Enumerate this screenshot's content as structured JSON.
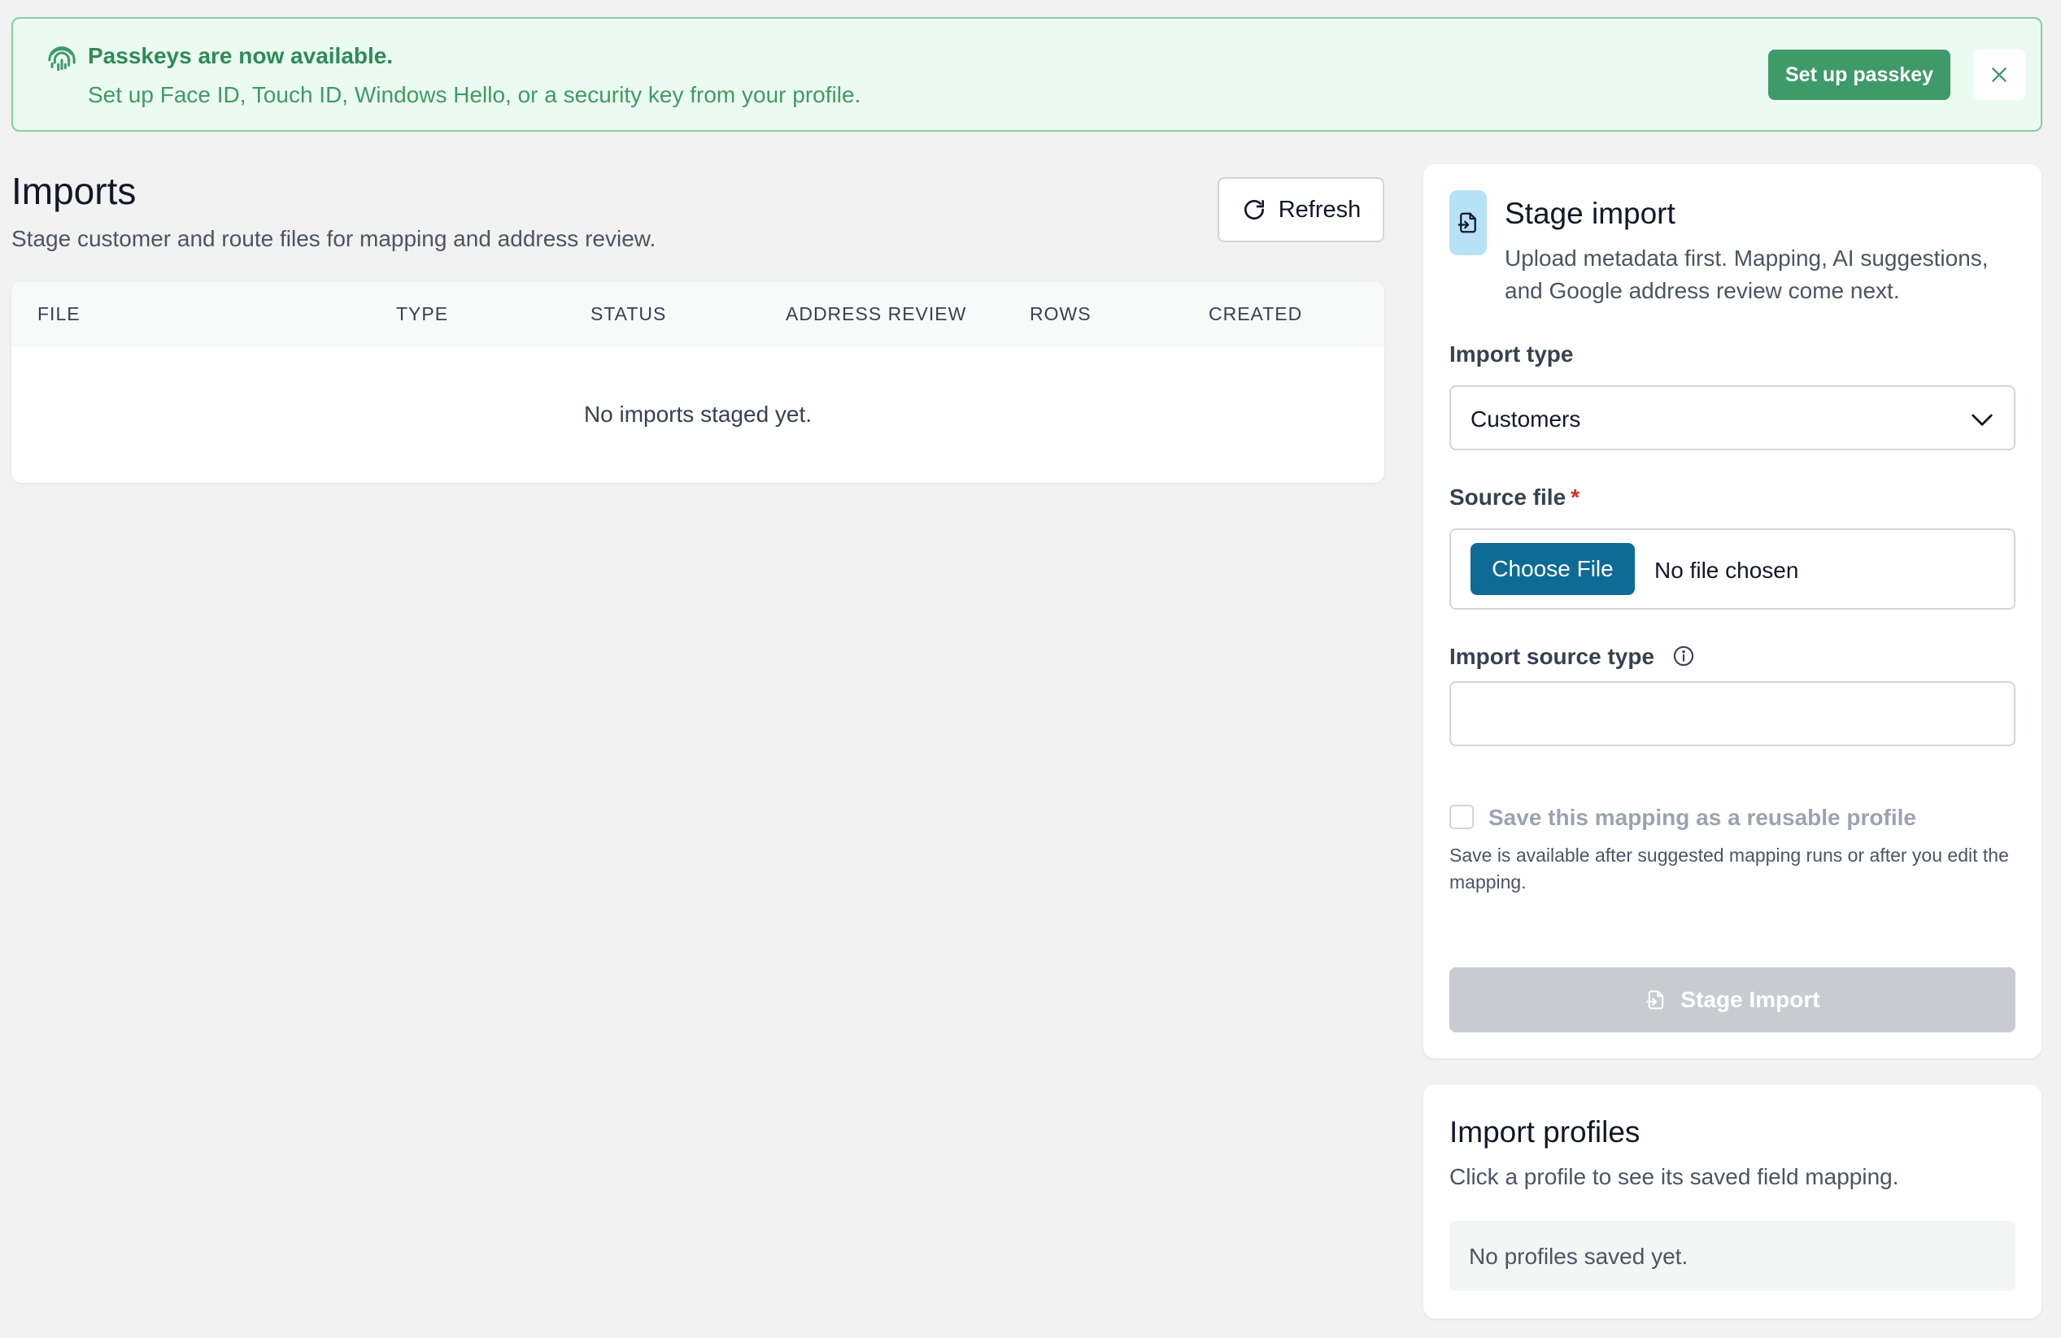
{
  "banner": {
    "title": "Passkeys are now available.",
    "subtitle": "Set up Face ID, Touch ID, Windows Hello, or a security key from your profile.",
    "setup_label": "Set up passkey",
    "icon": "fingerprint-icon",
    "accent_color": "#3e9a69"
  },
  "header": {
    "title": "Imports",
    "subtitle": "Stage customer and route files for mapping and address review.",
    "refresh_label": "Refresh"
  },
  "table": {
    "columns": [
      "FILE",
      "TYPE",
      "STATUS",
      "ADDRESS REVIEW",
      "ROWS",
      "CREATED"
    ],
    "empty_message": "No imports staged yet."
  },
  "stage": {
    "title": "Stage import",
    "subtitle": "Upload metadata first. Mapping, AI suggestions, and Google address review come next.",
    "import_type_label": "Import type",
    "import_type_value": "Customers",
    "source_file_label": "Source file",
    "required_mark": "*",
    "choose_file_label": "Choose File",
    "file_status": "No file chosen",
    "source_type_label": "Import source type",
    "source_type_value": "",
    "save_profile_label": "Save this mapping as a reusable profile",
    "save_help": "Save is available after suggested mapping runs or after you edit the mapping.",
    "stage_button_label": "Stage Import",
    "primary_color": "#0e6b95"
  },
  "profiles": {
    "title": "Import profiles",
    "subtitle": "Click a profile to see its saved field mapping.",
    "empty_message": "No profiles saved yet."
  }
}
